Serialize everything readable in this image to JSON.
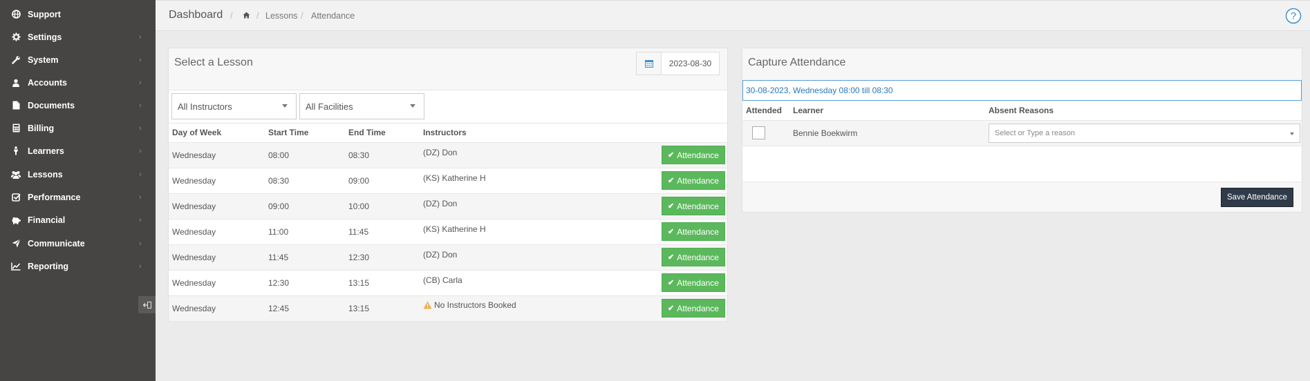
{
  "breadcrumb": {
    "title": "Dashboard",
    "items": [
      "Lessons",
      "Attendance"
    ]
  },
  "sidebar": {
    "items": [
      {
        "label": "Support",
        "icon": "globe-icon"
      },
      {
        "label": "Settings",
        "icon": "gear-icon"
      },
      {
        "label": "System",
        "icon": "wrench-icon"
      },
      {
        "label": "Accounts",
        "icon": "user-icon"
      },
      {
        "label": "Documents",
        "icon": "file-icon"
      },
      {
        "label": "Billing",
        "icon": "calculator-icon"
      },
      {
        "label": "Learners",
        "icon": "person-icon"
      },
      {
        "label": "Lessons",
        "icon": "users-icon"
      },
      {
        "label": "Performance",
        "icon": "check-square-icon"
      },
      {
        "label": "Financial",
        "icon": "piggy-bank-icon"
      },
      {
        "label": "Communicate",
        "icon": "send-icon"
      },
      {
        "label": "Reporting",
        "icon": "line-chart-icon"
      }
    ]
  },
  "lesson_panel": {
    "title": "Select a Lesson",
    "date": "2023-08-30",
    "instructor_filter": "All Instructors",
    "facility_filter": "All Facilities",
    "columns": [
      "Day of Week",
      "Start Time",
      "End Time",
      "Instructors"
    ],
    "button_label": "Attendance",
    "rows": [
      {
        "day": "Wednesday",
        "start": "08:00",
        "end": "08:30",
        "instructor": "(DZ) Don",
        "warning": false
      },
      {
        "day": "Wednesday",
        "start": "08:30",
        "end": "09:00",
        "instructor": "(KS) Katherine H",
        "warning": false
      },
      {
        "day": "Wednesday",
        "start": "09:00",
        "end": "10:00",
        "instructor": "(DZ) Don",
        "warning": false
      },
      {
        "day": "Wednesday",
        "start": "11:00",
        "end": "11:45",
        "instructor": "(KS) Katherine H",
        "warning": false
      },
      {
        "day": "Wednesday",
        "start": "11:45",
        "end": "12:30",
        "instructor": "(DZ) Don",
        "warning": false
      },
      {
        "day": "Wednesday",
        "start": "12:30",
        "end": "13:15",
        "instructor": "(CB) Carla",
        "warning": false
      },
      {
        "day": "Wednesday",
        "start": "12:45",
        "end": "13:15",
        "instructor": "No Instructors Booked",
        "warning": true
      }
    ]
  },
  "capture_panel": {
    "title": "Capture Attendance",
    "selected_lesson": "30-08-2023, Wednesday 08:00 till 08:30",
    "columns": [
      "Attended",
      "Learner",
      "Absent Reasons"
    ],
    "learners": [
      {
        "name": "Bennie Boekwirm",
        "attended": false,
        "reason_placeholder": "Select or Type a reason"
      }
    ],
    "save_label": "Save Attendance"
  },
  "colors": {
    "sidebar_bg": "#474544",
    "button_green": "#5cb85c",
    "save_dark": "#2f3b4b",
    "link_blue": "#2a7ab8",
    "warning": "#f0ad4e"
  }
}
